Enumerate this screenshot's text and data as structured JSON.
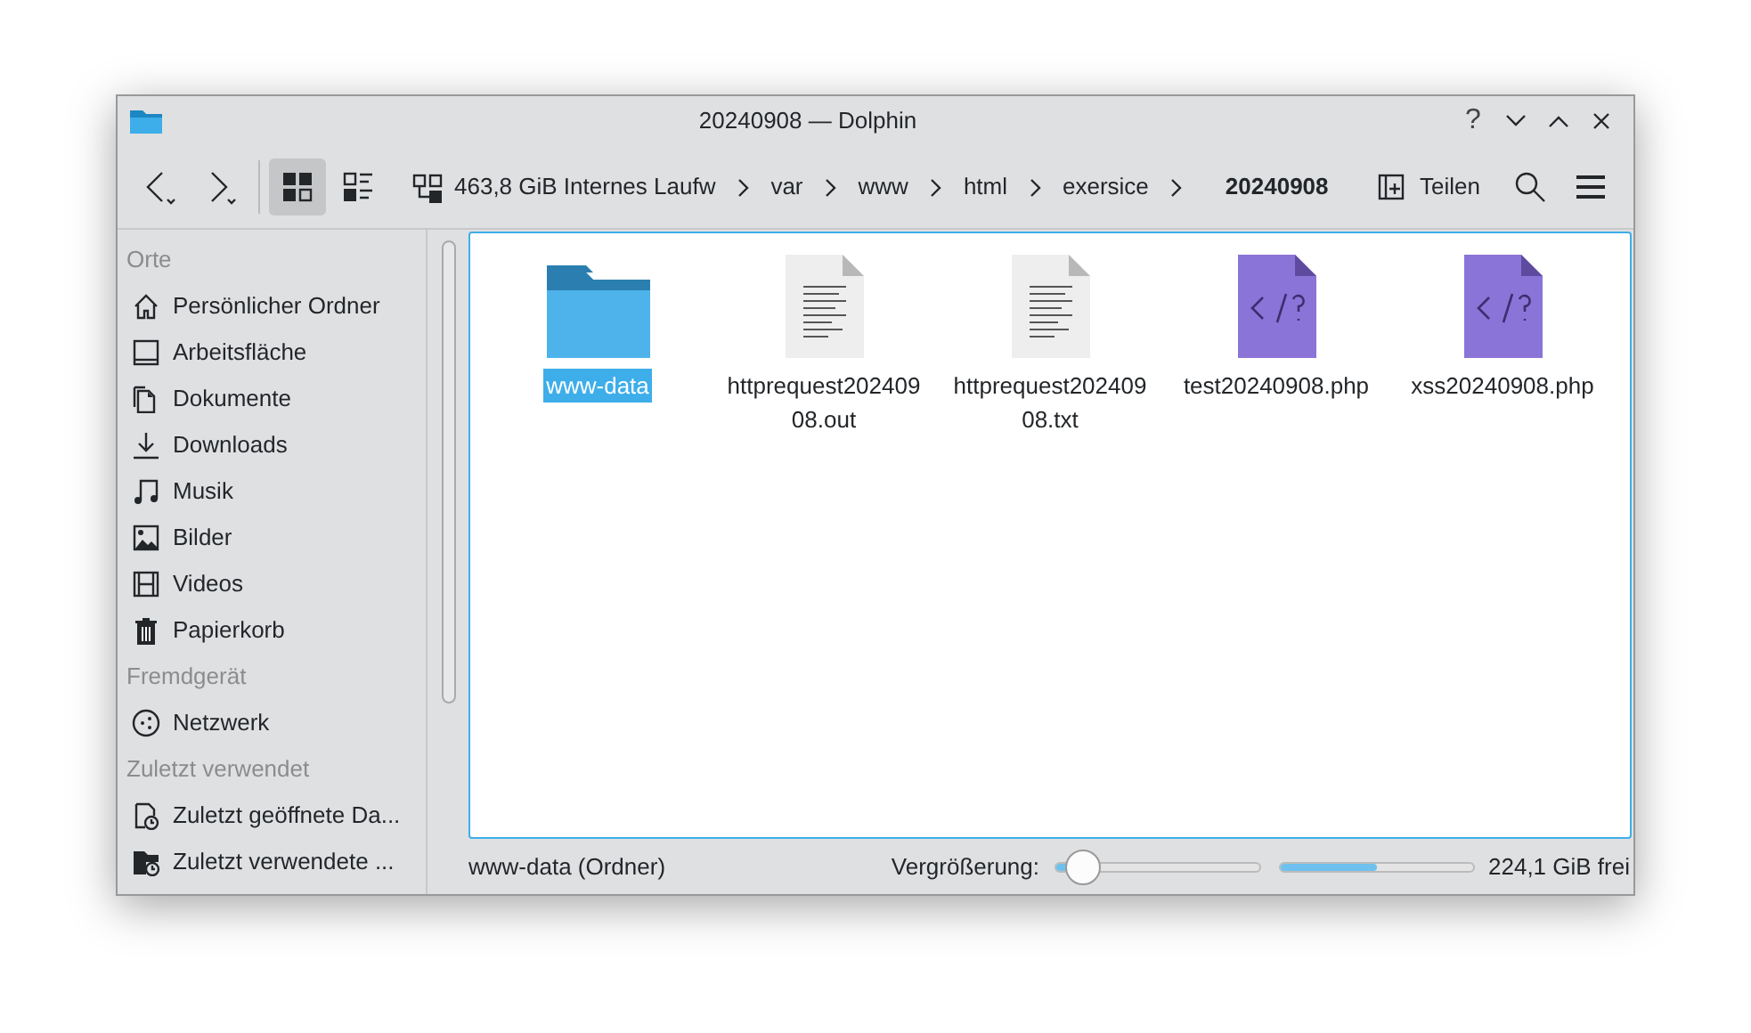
{
  "window": {
    "title": "20240908 — Dolphin",
    "controls": [
      "?"
    ]
  },
  "toolbar": {
    "view_modes": [
      {
        "kind": "icons",
        "selected": true
      },
      {
        "kind": "details",
        "selected": false
      }
    ],
    "breadcrumbs": [
      {
        "label": "463,8 GiB Internes Laufw",
        "current": false
      },
      {
        "label": "var",
        "current": false
      },
      {
        "label": "www",
        "current": false
      },
      {
        "label": "html",
        "current": false
      },
      {
        "label": "exersice",
        "current": false
      },
      {
        "label": "20240908",
        "current": true
      }
    ],
    "share": "Teilen"
  },
  "sidebar": [
    {
      "title": "Orte",
      "items": [
        {
          "label": "Persönlicher Ordner",
          "kind": "home"
        },
        {
          "label": "Arbeitsfläche",
          "kind": "desktop"
        },
        {
          "label": "Dokumente",
          "kind": "documents"
        },
        {
          "label": "Downloads",
          "kind": "downloads"
        },
        {
          "label": "Musik",
          "kind": "music"
        },
        {
          "label": "Bilder",
          "kind": "pictures"
        },
        {
          "label": "Videos",
          "kind": "videos"
        },
        {
          "label": "Papierkorb",
          "kind": "trash"
        }
      ]
    },
    {
      "title": "Fremdgerät",
      "items": [
        {
          "label": "Netzwerk",
          "kind": "network"
        }
      ]
    },
    {
      "title": "Zuletzt verwendet",
      "items": [
        {
          "label": "Zuletzt geöffnete Da...",
          "kind": "recent-file"
        },
        {
          "label": "Zuletzt verwendete ...",
          "kind": "recent-folder"
        }
      ]
    }
  ],
  "files": [
    {
      "name": "www-data",
      "kind": "folder",
      "selected": true
    },
    {
      "name": "httprequest20240908.out",
      "kind": "text",
      "selected": false
    },
    {
      "name": "httprequest20240908.txt",
      "kind": "text",
      "selected": false
    },
    {
      "name": "test20240908.php",
      "kind": "php",
      "selected": false
    },
    {
      "name": "xss20240908.php",
      "kind": "php",
      "selected": false
    }
  ],
  "status_bar": {
    "text": "www-data (Ordner)",
    "zoom_label": "Vergrößerung:",
    "zoom": {
      "level": 0.14
    },
    "disk": {
      "level": 0.5
    },
    "free": "224,1 GiB frei"
  }
}
